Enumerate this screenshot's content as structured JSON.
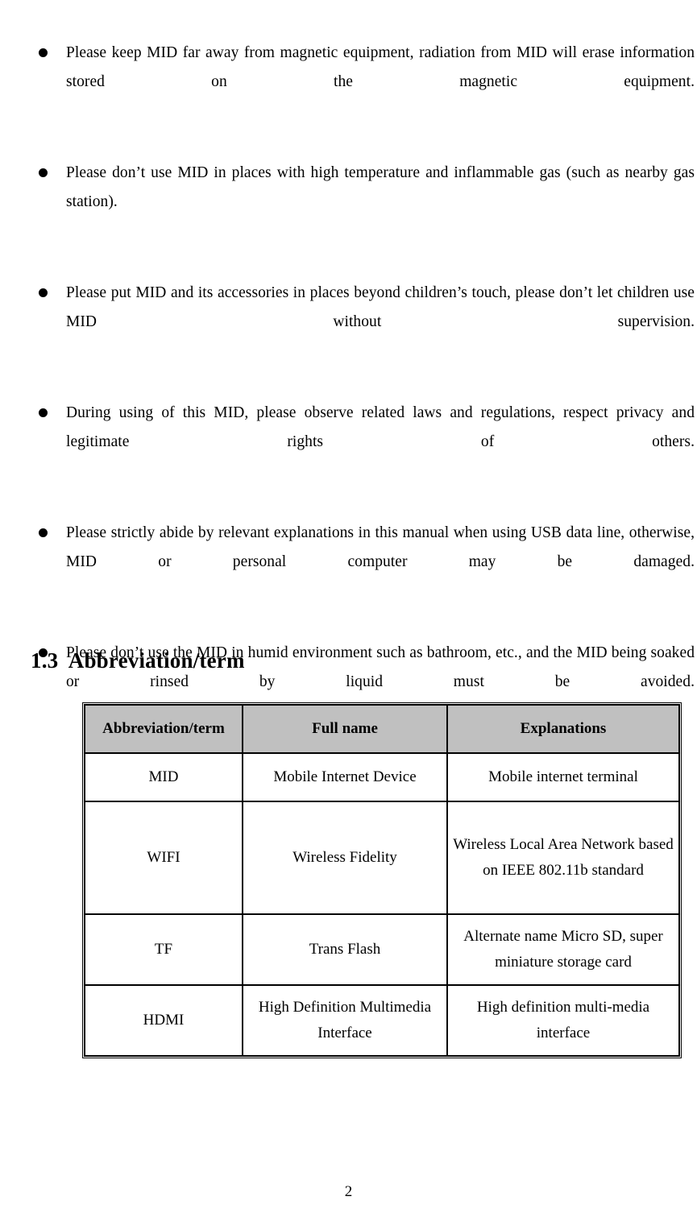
{
  "document": {
    "page_number": "2",
    "safety_bullets": [
      "Please keep MID far away from magnetic equipment, radiation from MID will erase information stored on the magnetic equipment.",
      "Please don’t use MID in places with high temperature and inflammable gas (such as nearby gas station).",
      "Please put MID and its accessories in places beyond children’s touch, please don’t let children use MID without supervision.",
      "During using of this MID, please observe related laws and regulations, respect privacy and legitimate rights of others.",
      "Please strictly abide by relevant explanations in this manual when using USB data line, otherwise, MID or personal computer may be damaged.",
      "Please don’t use the MID in humid environment such as bathroom, etc., and the MID being soaked or rinsed by liquid must be avoided."
    ],
    "section": {
      "number": "1.3",
      "title": "Abbreviation/term",
      "full_heading": "1.3  Abbreviation/term"
    },
    "abbreviation_table": {
      "headers": [
        "Abbreviation/term",
        "Full name",
        "Explanations"
      ],
      "rows": [
        {
          "abbrev": "MID",
          "full_name": "Mobile Internet Device",
          "explanation": "Mobile internet terminal"
        },
        {
          "abbrev": "WIFI",
          "full_name": "Wireless Fidelity",
          "explanation": "Wireless Local Area Network based on IEEE 802.11b standard"
        },
        {
          "abbrev": "TF",
          "full_name": "Trans Flash",
          "explanation": "Alternate name Micro SD, super miniature storage card"
        },
        {
          "abbrev": "HDMI",
          "full_name": "High Definition Multimedia Interface",
          "explanation": "High definition multi-media interface"
        }
      ]
    },
    "colors": {
      "header_fill": "#c0c0c0",
      "text": "#000000",
      "page_background": "#ffffff",
      "border": "#000000"
    }
  }
}
